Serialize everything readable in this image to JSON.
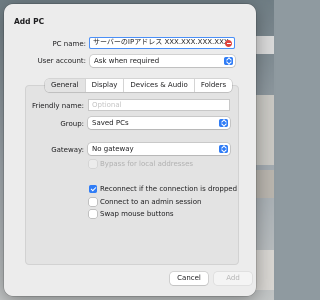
{
  "dialog": {
    "title": "Add PC",
    "pc_name_label": "PC name:",
    "pc_name_value": "サーバーのIPアドレス XXX.XXX.XXX.XXX",
    "user_account_label": "User account:",
    "user_account_value": "Ask when required"
  },
  "tabs": [
    "General",
    "Display",
    "Devices & Audio",
    "Folders"
  ],
  "general": {
    "friendly_name_label": "Friendly name:",
    "friendly_name_placeholder": "Optional",
    "group_label": "Group:",
    "group_value": "Saved PCs",
    "gateway_label": "Gateway:",
    "gateway_value": "No gateway",
    "bypass_label": "Bypass for local addresses",
    "reconnect_label": "Reconnect if the connection is dropped",
    "admin_label": "Connect to an admin session",
    "swap_label": "Swap mouse buttons"
  },
  "footer": {
    "cancel_label": "Cancel",
    "add_label": "Add"
  },
  "colors": {
    "accent": "#2f7cf6",
    "focus_ring": "#4a8ff7",
    "clear_button": "#e0443e"
  }
}
